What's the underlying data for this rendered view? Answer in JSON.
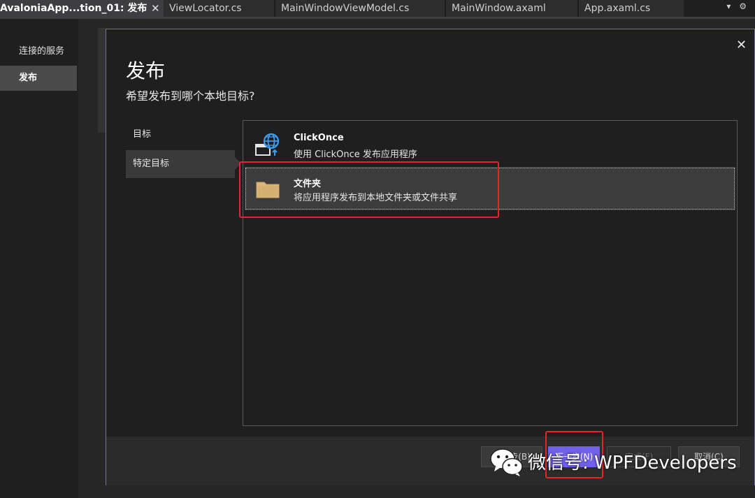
{
  "tabs": [
    {
      "label": "AvaloniaApp...tion_01: 发布",
      "active": true
    },
    {
      "label": "ViewLocator.cs",
      "active": false
    },
    {
      "label": "MainWindowViewModel.cs",
      "active": false
    },
    {
      "label": "MainWindow.axaml",
      "active": false
    },
    {
      "label": "App.axaml.cs",
      "active": false
    }
  ],
  "tab_pin_glyph": "⊣",
  "tab_close_glyph": "✕",
  "tab_menu_glyph": "▾ ⚙",
  "leftnav": {
    "items": [
      {
        "label": "连接的服务",
        "selected": false
      },
      {
        "label": "发布",
        "selected": true
      }
    ]
  },
  "dialog": {
    "title": "发布",
    "subtitle": "希望发布到哪个本地目标?",
    "close_glyph": "✕",
    "sidebar": [
      {
        "label": "目标",
        "selected": false
      },
      {
        "label": "特定目标",
        "selected": true
      }
    ],
    "options": [
      {
        "title": "ClickOnce",
        "description": "使用 ClickOnce 发布应用程序",
        "icon": "globe-window-icon",
        "selected": false
      },
      {
        "title": "文件夹",
        "description": "将应用程序发布到本地文件夹或文件共享",
        "icon": "folder-icon",
        "selected": true
      }
    ],
    "footer": {
      "back_label": "上一步(B)",
      "next_label": "下一步(N)",
      "finish_label": "完成(F)",
      "cancel_label": "取消(C)"
    }
  },
  "watermark": {
    "text": "微信号: WPFDevelopers",
    "icon": "wechat-icon"
  },
  "colors": {
    "accent": "#7160e8",
    "highlight": "#e8242a",
    "background": "#1f1f1f"
  }
}
